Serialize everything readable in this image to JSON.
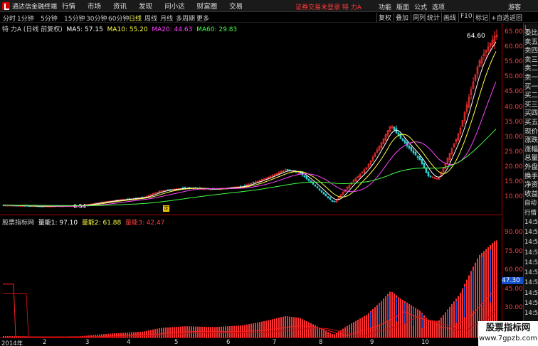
{
  "titlebar": {
    "app_title": "通达信金融终端",
    "menus": [
      "行情",
      "市场",
      "资讯",
      "发现",
      "问小达",
      "财富圈",
      "交易"
    ],
    "warning": "证券交易未登录  特 力A",
    "right_menus": [
      "功能",
      "版面",
      "公式",
      "选项",
      "游客"
    ]
  },
  "periodbar": {
    "periods": [
      "分时",
      "1分钟",
      "5分钟",
      "15分钟",
      "30分钟",
      "60分钟",
      "日线",
      "周线",
      "月线",
      "多周期",
      "更多"
    ],
    "active": "日线",
    "tools": [
      "复权",
      "叠加",
      "同列",
      "统计",
      "画线",
      "F10",
      "标记",
      "+自选",
      "返回"
    ]
  },
  "price_info": {
    "title": "特 力A (日线 前复权)",
    "ma5": "MA5: 57.15",
    "ma10": "MA10: 55.20",
    "ma20": "MA20: 44.63",
    "ma60": "MA60: 29.83",
    "high_label": "64.60",
    "low_label": "6.54",
    "marker": "定"
  },
  "indicator_info": {
    "title": "股票指标网",
    "v1": "量能1: 97.10",
    "v2": "量能2: 61.88",
    "v3": "量能3: 42.47",
    "last": "47.30"
  },
  "price_axis": [
    "65.00",
    "60.00",
    "55.00",
    "50.00",
    "45.00",
    "40.00",
    "35.00",
    "30.00",
    "25.00",
    "20.00",
    "15.00",
    "10.00"
  ],
  "ind_axis": [
    "90.00",
    "75.00",
    "60.00",
    "45.00",
    "30.00",
    "15.00"
  ],
  "x_axis": [
    "2014年",
    "2",
    "3",
    "4",
    "5",
    "6",
    "7",
    "8",
    "9",
    "10"
  ],
  "side_labels": [
    "委比",
    "卖五",
    "卖四",
    "卖三",
    "卖二",
    "卖一",
    "买一",
    "买二",
    "买三",
    "买四",
    "买五",
    "现价",
    "涨跌",
    "涨幅",
    "总量",
    "外盘",
    "换手",
    "净资",
    "收益"
  ],
  "side_top": "L",
  "side_bottom": [
    "自动",
    "行情",
    "14:50",
    "14:50",
    "14:50",
    "14:50",
    "14:50",
    "14:50",
    "14:50",
    "14:50",
    "14:50",
    "14:50"
  ],
  "watermark": {
    "line1": "股票指标网",
    "line2": "www.7gpzb.com"
  },
  "colors": {
    "up": "#ff3030",
    "down": "#30d0d0",
    "axis": "#ff4040",
    "ma5": "#ffffff",
    "ma10": "#ffff44",
    "ma20": "#ff44ff",
    "ma60": "#44ff44"
  }
}
